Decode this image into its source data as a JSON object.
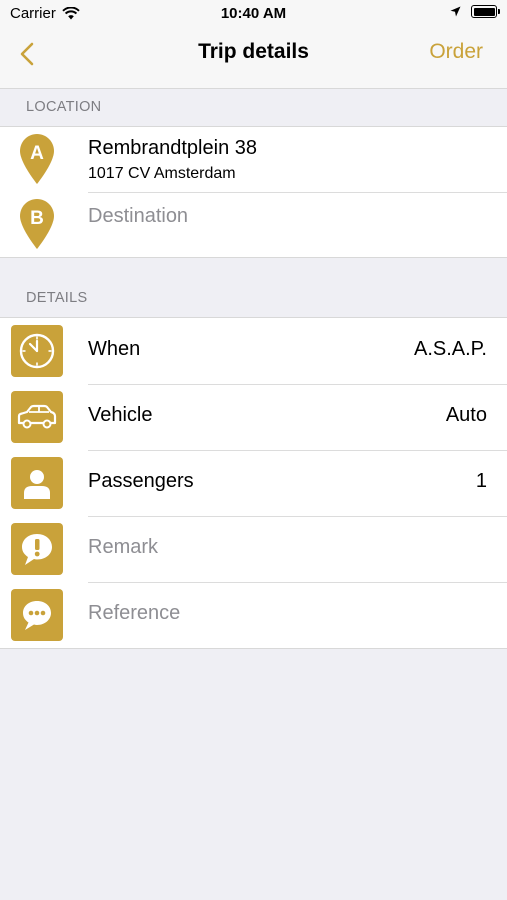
{
  "status_bar": {
    "carrier": "Carrier",
    "time": "10:40 AM"
  },
  "nav": {
    "title": "Trip details",
    "order_label": "Order"
  },
  "location": {
    "header": "LOCATION",
    "pickup": {
      "marker": "A",
      "title": "Rembrandtplein 38",
      "subtitle": "1017 CV Amsterdam"
    },
    "destination": {
      "marker": "B",
      "placeholder": "Destination"
    }
  },
  "details": {
    "header": "DETAILS",
    "rows": [
      {
        "icon": "clock-icon",
        "label": "When",
        "value": "A.S.A.P."
      },
      {
        "icon": "car-icon",
        "label": "Vehicle",
        "value": "Auto"
      },
      {
        "icon": "person-icon",
        "label": "Passengers",
        "value": "1"
      },
      {
        "icon": "exclamation-bubble-icon",
        "label": "Remark",
        "value": ""
      },
      {
        "icon": "chat-bubble-icon",
        "label": "Reference",
        "value": ""
      }
    ]
  },
  "colors": {
    "accent": "#c9a23a",
    "background": "#efeff4",
    "placeholder": "#8e8e93"
  }
}
